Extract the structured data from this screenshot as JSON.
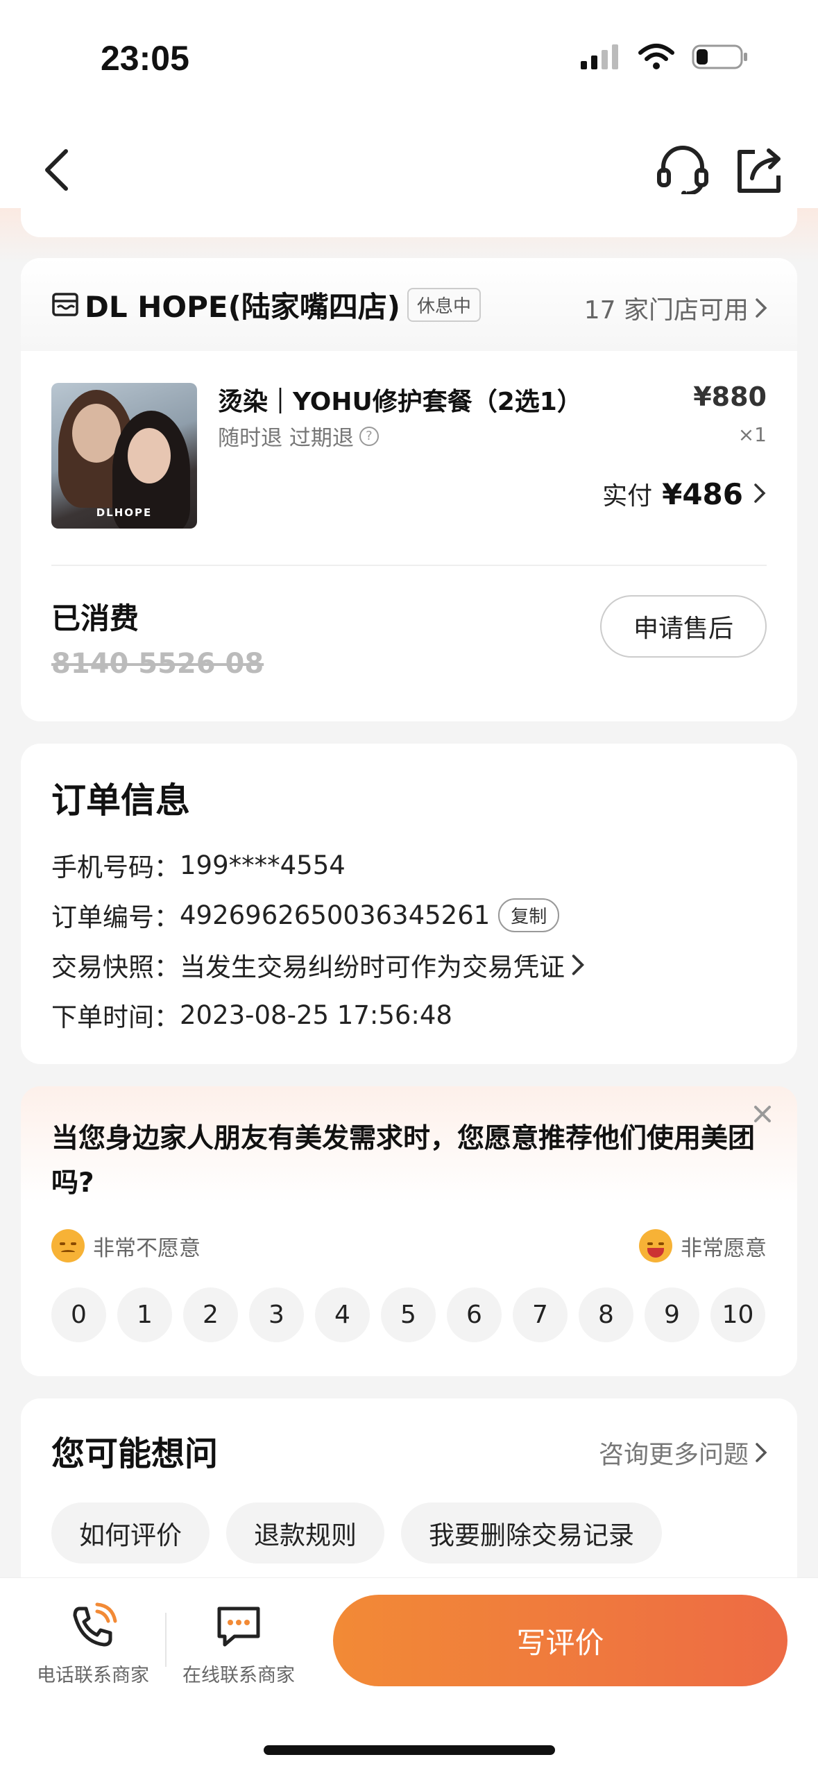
{
  "status_bar": {
    "time": "23:05"
  },
  "store": {
    "name": "DL HOPE(陆家嘴四店)",
    "status_badge": "休息中",
    "available_stores": "17 家门店可用"
  },
  "product": {
    "image_brand": "DLHOPE",
    "title": "烫染｜YOHU修护套餐（2选1）",
    "refund_policy": "随时退 过期退",
    "price": "¥880",
    "quantity": "×1",
    "paid_label": "实付",
    "paid_amount": "¥486"
  },
  "consumption": {
    "status": "已消费",
    "code": "8140 5526 08",
    "after_sale_label": "申请售后"
  },
  "order_info": {
    "title": "订单信息",
    "phone_label": "手机号码：",
    "phone": "199****4554",
    "order_no_label": "订单编号：",
    "order_no": "4926962650036345261",
    "copy_label": "复制",
    "snapshot_label": "交易快照：",
    "snapshot_text": "当发生交易纠纷时可作为交易凭证",
    "time_label": "下单时间：",
    "time": "2023-08-25 17:56:48"
  },
  "survey": {
    "question": "当您身边家人朋友有美发需求时，您愿意推荐他们使用美团吗?",
    "low_label": "非常不愿意",
    "high_label": "非常愿意",
    "scores": [
      "0",
      "1",
      "2",
      "3",
      "4",
      "5",
      "6",
      "7",
      "8",
      "9",
      "10"
    ]
  },
  "faq": {
    "title": "您可能想问",
    "more_label": "咨询更多问题",
    "chips": [
      "如何评价",
      "退款规则",
      "我要删除交易记录"
    ]
  },
  "bottom_bar": {
    "phone_label": "电话联系商家",
    "chat_label": "在线联系商家",
    "write_review_label": "写评价"
  },
  "colors": {
    "accent_start": "#f28a36",
    "accent_end": "#ed6b44",
    "page_bg": "#f4f4f4"
  }
}
